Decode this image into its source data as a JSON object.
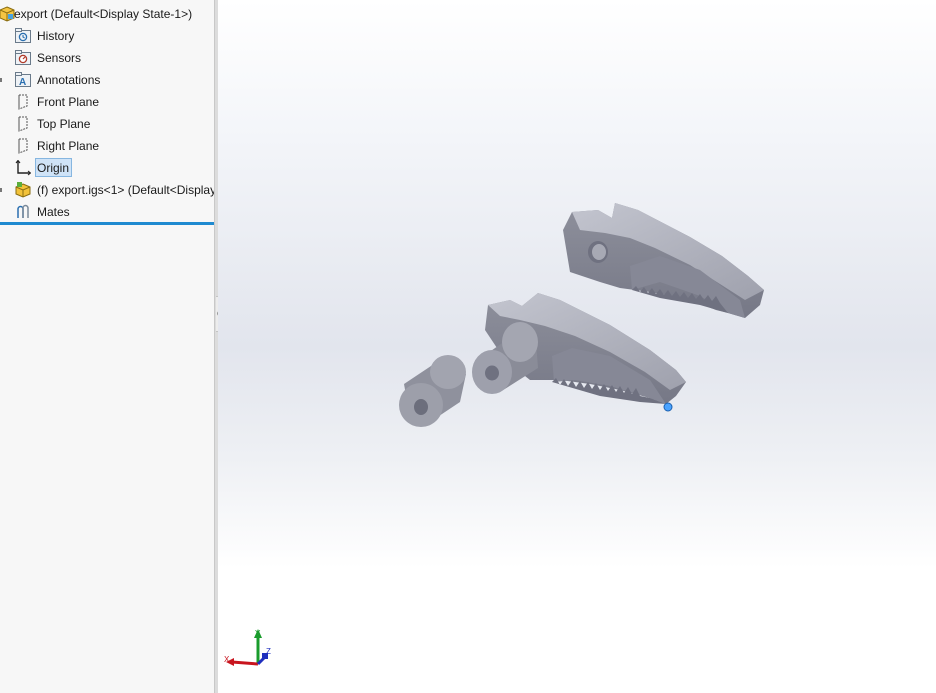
{
  "feature_tree": {
    "root": {
      "label": "export  (Default<Display State-1>)",
      "icon": "assembly-icon"
    },
    "items": [
      {
        "label": "History",
        "icon": "history-folder-icon"
      },
      {
        "label": "Sensors",
        "icon": "sensors-folder-icon"
      },
      {
        "label": "Annotations",
        "icon": "annotations-folder-icon"
      },
      {
        "label": "Front Plane",
        "icon": "plane-icon"
      },
      {
        "label": "Top Plane",
        "icon": "plane-icon"
      },
      {
        "label": "Right Plane",
        "icon": "plane-icon"
      },
      {
        "label": "Origin",
        "icon": "origin-icon",
        "selected": true
      },
      {
        "label": "(f) export.igs<1> (Default<Display",
        "icon": "part-icon"
      },
      {
        "label": "Mates",
        "icon": "mates-icon"
      }
    ]
  },
  "triad": {
    "x_label": "X",
    "y_label": "Y",
    "z_label": "Z"
  },
  "colors": {
    "part": "#9a9ca8",
    "part_dark": "#6f7180",
    "part_light": "#b9bbc6",
    "selection": "#cfe3f7",
    "rollback_bar": "#1f8ad0"
  }
}
